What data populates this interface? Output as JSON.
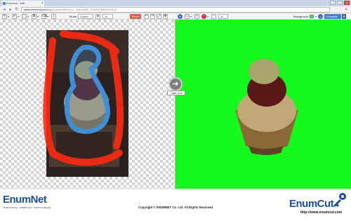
{
  "browser": {
    "tab_title": "Enumcut - edit",
    "tab_close": "×",
    "url_host": "www.enumcut.com",
    "url_path": "/bgcontrol/edit?num=...&id=N462_20160125000010142",
    "nav_back": "◂",
    "nav_forward": "▸",
    "nav_reload": "↻",
    "menu": "≡",
    "win_min": "–",
    "win_max": "□",
    "win_close": "×"
  },
  "toolbar": {
    "mode_label": "Mode:",
    "mode_value": "Expert",
    "brush_size_value": "10",
    "reset_label": "Reset",
    "zoom_value": "10",
    "background_label": "Background",
    "background_color": "#16f91c",
    "complete_label": "Complete",
    "complete_icon": "⚙",
    "caret": "▾"
  },
  "workspace": {
    "start_cut_arrow": "➜",
    "start_cut_label": "Start Cut"
  },
  "footer": {
    "enumnet_logo": "EnumNet",
    "enumnet_tagline": "Smart thinking · software and · service company",
    "copyright": "Copyright © ENUMNET Co. Ltd. All Rights Reserved",
    "enumcut_logo": "EnumCut",
    "enumcut_url": "http://www.enumcut.com"
  },
  "colors": {
    "foreground_stroke": "#3e8fd6",
    "background_stroke": "#ff2a12",
    "result_background": "#16f91c"
  }
}
